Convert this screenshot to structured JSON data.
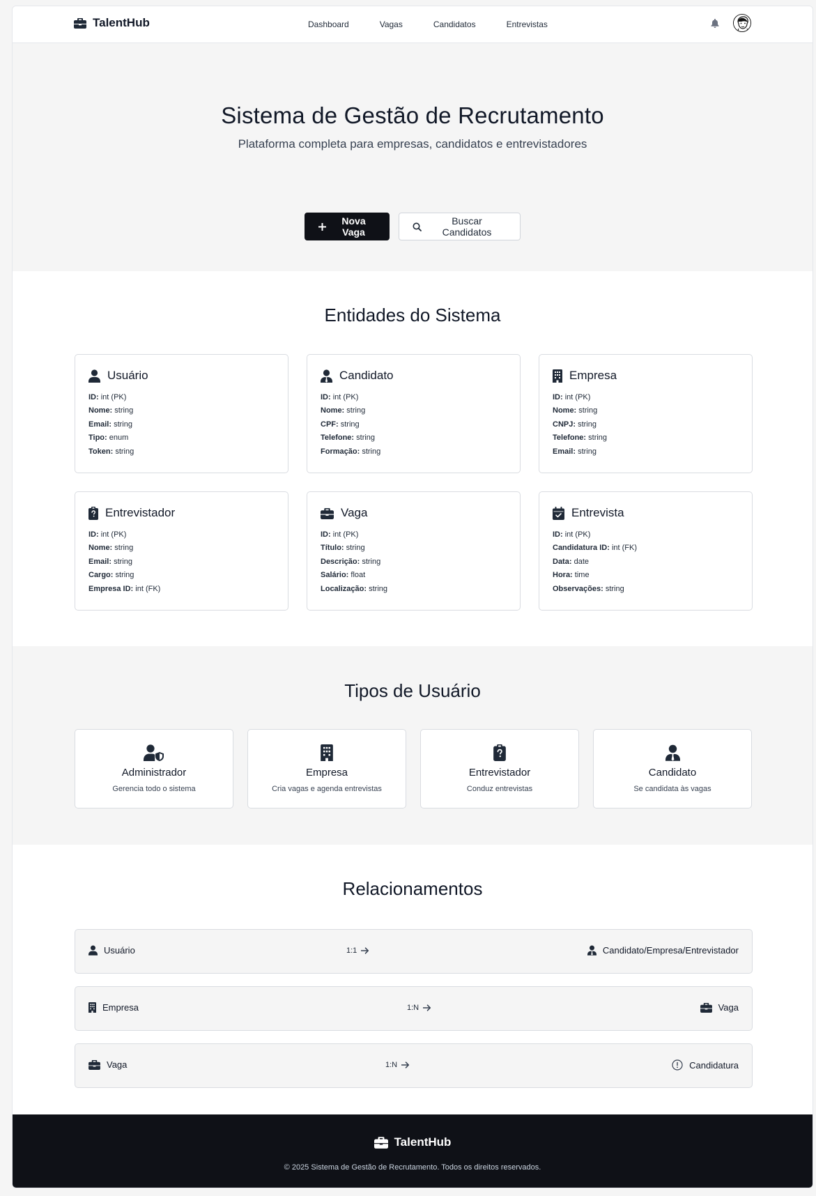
{
  "brand": {
    "name": "TalentHub"
  },
  "nav": {
    "links": [
      "Dashboard",
      "Vagas",
      "Candidatos",
      "Entrevistas"
    ]
  },
  "hero": {
    "title": "Sistema de Gestão de Recrutamento",
    "subtitle": "Plataforma completa para empresas, candidatos e entrevistadores",
    "primary_button": "Nova Vaga",
    "secondary_button": "Buscar Candidatos"
  },
  "entities": {
    "title": "Entidades do Sistema",
    "cards": [
      {
        "title": "Usuário",
        "icon": "user-icon",
        "fields": [
          {
            "k": "ID:",
            "v": "int (PK)"
          },
          {
            "k": "Nome:",
            "v": "string"
          },
          {
            "k": "Email:",
            "v": "string"
          },
          {
            "k": "Tipo:",
            "v": "enum"
          },
          {
            "k": "Token:",
            "v": "string"
          }
        ]
      },
      {
        "title": "Candidato",
        "icon": "user-tie-icon",
        "fields": [
          {
            "k": "ID:",
            "v": "int (PK)"
          },
          {
            "k": "Nome:",
            "v": "string"
          },
          {
            "k": "CPF:",
            "v": "string"
          },
          {
            "k": "Telefone:",
            "v": "string"
          },
          {
            "k": "Formação:",
            "v": "string"
          }
        ]
      },
      {
        "title": "Empresa",
        "icon": "building-icon",
        "fields": [
          {
            "k": "ID:",
            "v": "int (PK)"
          },
          {
            "k": "Nome:",
            "v": "string"
          },
          {
            "k": "CNPJ:",
            "v": "string"
          },
          {
            "k": "Telefone:",
            "v": "string"
          },
          {
            "k": "Email:",
            "v": "string"
          }
        ]
      },
      {
        "title": "Entrevistador",
        "icon": "clipboard-question-icon",
        "fields": [
          {
            "k": "ID:",
            "v": "int (PK)"
          },
          {
            "k": "Nome:",
            "v": "string"
          },
          {
            "k": "Email:",
            "v": "string"
          },
          {
            "k": "Cargo:",
            "v": "string"
          },
          {
            "k": "Empresa ID:",
            "v": "int (FK)"
          }
        ]
      },
      {
        "title": "Vaga",
        "icon": "briefcase-icon",
        "fields": [
          {
            "k": "ID:",
            "v": "int (PK)"
          },
          {
            "k": "Título:",
            "v": "string"
          },
          {
            "k": "Descrição:",
            "v": "string"
          },
          {
            "k": "Salário:",
            "v": "float"
          },
          {
            "k": "Localização:",
            "v": "string"
          }
        ]
      },
      {
        "title": "Entrevista",
        "icon": "calendar-check-icon",
        "fields": [
          {
            "k": "ID:",
            "v": "int (PK)"
          },
          {
            "k": "Candidatura ID:",
            "v": "int (FK)"
          },
          {
            "k": "Data:",
            "v": "date"
          },
          {
            "k": "Hora:",
            "v": "time"
          },
          {
            "k": "Observações:",
            "v": "string"
          }
        ]
      }
    ]
  },
  "user_types": {
    "title": "Tipos de Usuário",
    "items": [
      {
        "title": "Administrador",
        "desc": "Gerencia todo o sistema",
        "icon": "user-shield-icon"
      },
      {
        "title": "Empresa",
        "desc": "Cria vagas e agenda entrevistas",
        "icon": "building-icon"
      },
      {
        "title": "Entrevistador",
        "desc": "Conduz entrevistas",
        "icon": "clipboard-question-icon"
      },
      {
        "title": "Candidato",
        "desc": "Se candidata às vagas",
        "icon": "user-tie-icon"
      }
    ]
  },
  "relations": {
    "title": "Relacionamentos",
    "items": [
      {
        "left": "Usuário",
        "left_icon": "user-icon",
        "card": "1:1",
        "right": "Candidato/Empresa/Entrevistador",
        "right_icon": "user-tie-icon"
      },
      {
        "left": "Empresa",
        "left_icon": "building-icon",
        "card": "1:N",
        "right": "Vaga",
        "right_icon": "briefcase-icon"
      },
      {
        "left": "Vaga",
        "left_icon": "briefcase-icon",
        "card": "1:N",
        "right": "Candidatura",
        "right_icon": "exclamation-circle-icon"
      }
    ]
  },
  "footer": {
    "brand": "TalentHub",
    "copyright": "© 2025 Sistema de Gestão de Recrutamento. Todos os direitos reservados."
  }
}
